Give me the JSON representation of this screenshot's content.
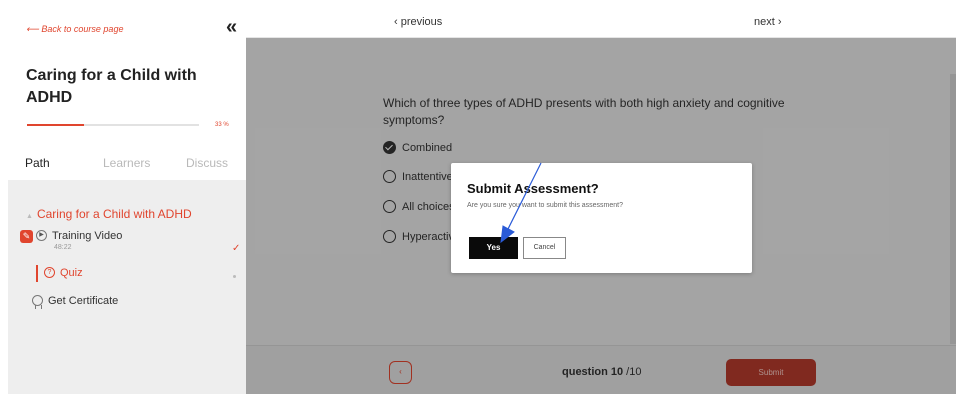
{
  "sidebar": {
    "back_link": "⟵ Back to course page",
    "collapse_icon": "«",
    "course_title": "Caring for a Child with ADHD",
    "progress_fraction": 0.33,
    "progress_label": "33 %",
    "tabs": [
      {
        "label": "Path",
        "active": true
      },
      {
        "label": "Learners",
        "active": false
      },
      {
        "label": "Discuss",
        "active": false
      }
    ],
    "section_title": "Caring for a Child with ADHD",
    "items": [
      {
        "label": "Training Video",
        "duration": "48:22",
        "status_icon": "check-icon"
      },
      {
        "label": "Quiz",
        "active": true
      },
      {
        "label": "Get Certificate"
      }
    ]
  },
  "topnav": {
    "previous": "‹ previous",
    "next": "next ›"
  },
  "question": {
    "text": "Which of three types of ADHD presents with both high anxiety and cognitive symptoms?",
    "options": [
      {
        "label": "Combined",
        "checked": true
      },
      {
        "label": "Inattentive",
        "checked": false
      },
      {
        "label": "All choices",
        "checked": false
      },
      {
        "label": "Hyperactive",
        "checked": false
      }
    ]
  },
  "bottombar": {
    "counter_current": "question 10",
    "counter_total": " /10",
    "submit_label": "Submit"
  },
  "modal": {
    "title": "Submit Assessment?",
    "message": "Are you sure you want to submit this assessment?",
    "yes_label": "Yes",
    "cancel_label": "Cancel"
  },
  "colors": {
    "accent": "#e0452e",
    "annotation_arrow": "#2a5bd7"
  }
}
